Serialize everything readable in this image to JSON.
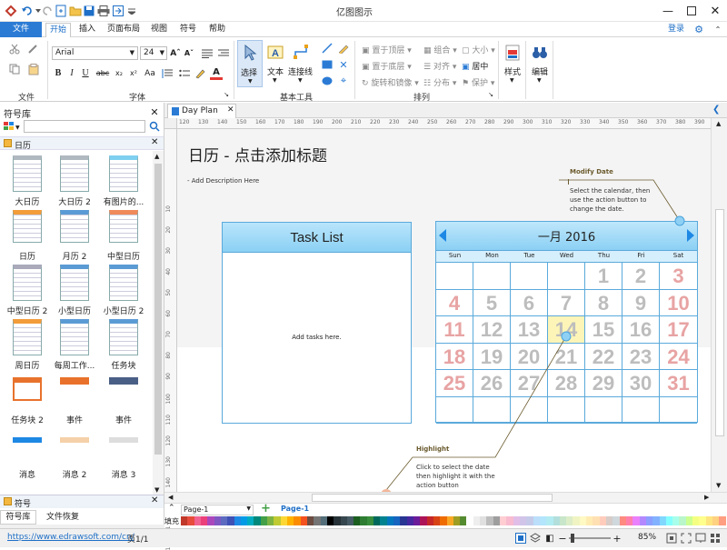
{
  "app": {
    "title": "亿图图示"
  },
  "menu": {
    "file": "文件",
    "tabs": [
      "开始",
      "插入",
      "页面布局",
      "视图",
      "符号",
      "帮助"
    ],
    "login": "登录"
  },
  "ribbon": {
    "font_name": "Arial",
    "font_size": "24",
    "groups": {
      "file": "文件",
      "font": "字体",
      "basic": "基本工具",
      "arrange": "排列"
    },
    "tools": {
      "select": "选择",
      "text": "文本",
      "connector": "连接线"
    },
    "arrange": {
      "bring_front": "置于顶层",
      "send_back": "置于底层",
      "rotate": "旋转和镜像",
      "group": "组合",
      "align": "对齐",
      "distribute": "分布",
      "size": "大小",
      "center": "居中",
      "protect": "保护"
    },
    "style": "样式",
    "edit": "编辑"
  },
  "library": {
    "title": "符号库",
    "search_placeholder": "",
    "category": "日历",
    "symbols": [
      "大日历",
      "大日历 2",
      "有图片的...",
      "日历",
      "月历 2",
      "中型日历",
      "中型日历 2",
      "小型日历",
      "小型日历 2",
      "周日历",
      "每周工作...",
      "任务块",
      "任务块 2",
      "事件",
      "事件",
      "消息",
      "消息 2",
      "消息 3"
    ],
    "bottom_title": "符号",
    "bottom_tabs": [
      "符号库",
      "文件恢复"
    ]
  },
  "doc": {
    "tab": "Day Plan"
  },
  "ruler": {
    "h": [
      "120",
      "130",
      "140",
      "150",
      "160",
      "170",
      "180",
      "190",
      "200",
      "210",
      "220",
      "230",
      "240",
      "250",
      "260",
      "270",
      "280",
      "290",
      "300",
      "310",
      "320",
      "330",
      "340",
      "350",
      "360",
      "370",
      "380",
      "390"
    ],
    "v": [
      "10",
      "20",
      "30",
      "40",
      "50",
      "60",
      "70",
      "80",
      "90",
      "100",
      "110",
      "120",
      "130",
      "140",
      "150",
      "160",
      "170"
    ]
  },
  "page": {
    "title": "日历 - 点击添加标题",
    "description": "- Add Description Here",
    "task_list": {
      "title": "Task List",
      "body": "Add tasks here."
    },
    "calendar": {
      "month": "一月 2016",
      "days": [
        "Sun",
        "Mon",
        "Tue",
        "Wed",
        "Thu",
        "Fri",
        "Sat"
      ],
      "weeks": [
        [
          "",
          "",
          "",
          "",
          "1",
          "2",
          "3"
        ],
        [
          "4",
          "5",
          "6",
          "7",
          "8",
          "9",
          "10"
        ],
        [
          "11",
          "12",
          "13",
          "14",
          "15",
          "16",
          "17"
        ],
        [
          "18",
          "19",
          "20",
          "21",
          "22",
          "23",
          "24"
        ],
        [
          "25",
          "26",
          "27",
          "28",
          "29",
          "30",
          "31"
        ],
        [
          "",
          "",
          "",
          "",
          "",
          "",
          ""
        ]
      ],
      "highlight": "14"
    },
    "modify": {
      "title": "Modify Date",
      "body": "Select the calendar, then use the action button to change the date."
    },
    "highlight_note": {
      "title": "Highlight",
      "body": "Click to select the date then highlight it with the action button"
    }
  },
  "pages": {
    "current": "Page-1",
    "tab": "Page-1"
  },
  "fill_label": "填充",
  "palette": [
    "#c0392b",
    "#e74c3c",
    "#f06292",
    "#ec407a",
    "#ab47bc",
    "#7e57c2",
    "#5c6bc0",
    "#3f51b5",
    "#1e88e5",
    "#039be5",
    "#00acc1",
    "#00897b",
    "#43a047",
    "#7cb342",
    "#c0ca33",
    "#fdd835",
    "#ffb300",
    "#fb8c00",
    "#f4511e",
    "#6d4c41",
    "#757575",
    "#546e7a",
    "#000000",
    "#263238",
    "#37474f",
    "#455a64",
    "#1b5e20",
    "#2e7d32",
    "#388e3c",
    "#00695c",
    "#00838f",
    "#0277bd",
    "#1565c0",
    "#283593",
    "#4527a0",
    "#6a1b9a",
    "#ad1457",
    "#c62828",
    "#d84315",
    "#ef6c00",
    "#f9a825",
    "#9e9d24",
    "#558b2f",
    "#ffffff",
    "#eeeeee",
    "#e0e0e0",
    "#bdbdbd",
    "#9e9e9e",
    "#ffcdd2",
    "#f8bbd0",
    "#e1bee7",
    "#d1c4e9",
    "#c5cae9",
    "#bbdefb",
    "#b3e5fc",
    "#b2ebf2",
    "#b2dfdb",
    "#c8e6c9",
    "#dcedc8",
    "#f0f4c3",
    "#fff9c4",
    "#ffecb3",
    "#ffe0b2",
    "#ffccbc",
    "#d7ccc8",
    "#cfd8dc",
    "#ff8a80",
    "#ff80ab",
    "#ea80fc",
    "#b388ff",
    "#8c9eff",
    "#82b1ff",
    "#80d8ff",
    "#84ffff",
    "#a7ffeb",
    "#b9f6ca",
    "#ccff90",
    "#f4ff81",
    "#ffff8d",
    "#ffe57f",
    "#ffd180",
    "#ff9e80"
  ],
  "status": {
    "url": "https://www.edrawsoft.com/cn/",
    "page": "页1/1",
    "zoom": "85%"
  }
}
